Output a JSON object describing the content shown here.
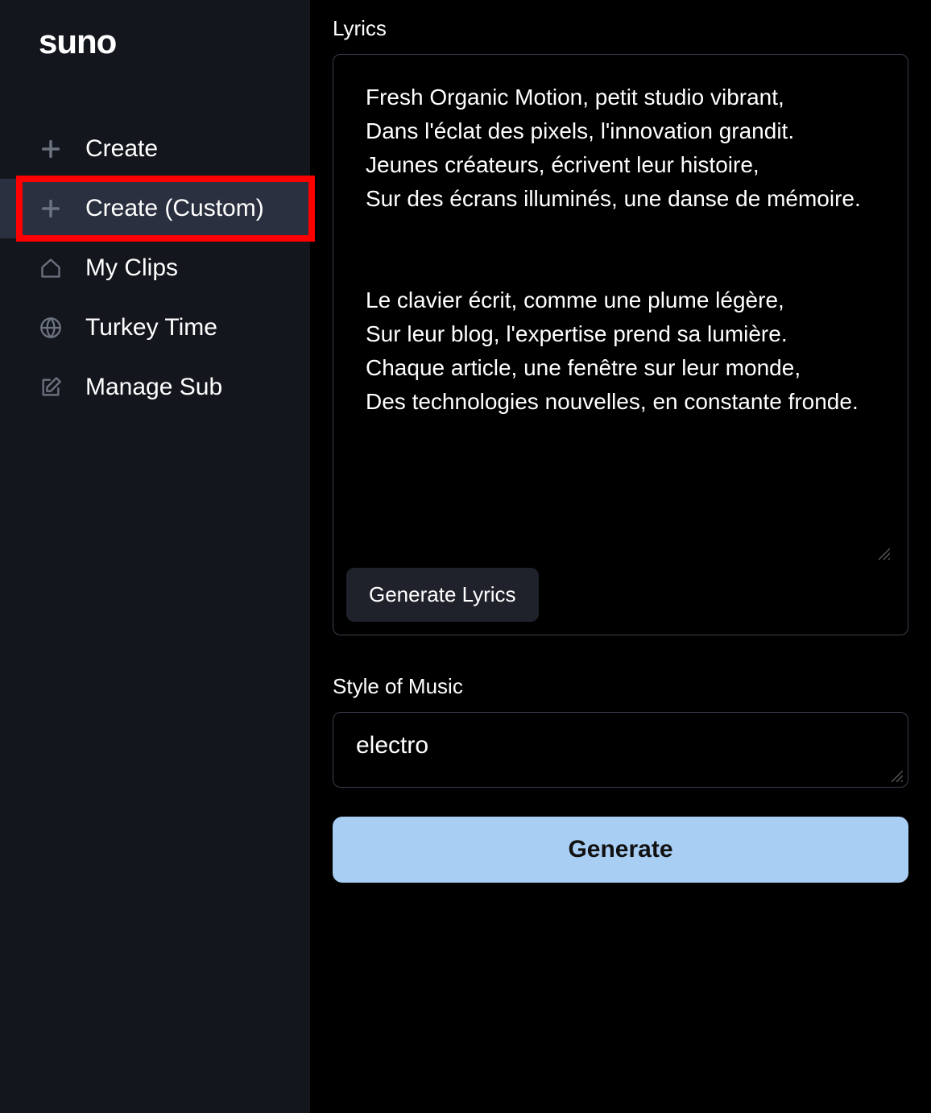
{
  "brand": "suno",
  "sidebar": {
    "items": [
      {
        "label": "Create",
        "icon": "plus"
      },
      {
        "label": "Create (Custom)",
        "icon": "plus",
        "active": true,
        "highlighted": true
      },
      {
        "label": "My Clips",
        "icon": "home"
      },
      {
        "label": "Turkey Time",
        "icon": "globe"
      },
      {
        "label": "Manage Sub",
        "icon": "edit"
      }
    ]
  },
  "form": {
    "lyrics_label": "Lyrics",
    "lyrics_value": "Fresh Organic Motion, petit studio vibrant,\nDans l'éclat des pixels, l'innovation grandit.\nJeunes créateurs, écrivent leur histoire,\nSur des écrans illuminés, une danse de mémoire.\n\n\nLe clavier écrit, comme une plume légère,\nSur leur blog, l'expertise prend sa lumière.\nChaque article, une fenêtre sur leur monde,\nDes technologies nouvelles, en constante fronde.",
    "generate_lyrics_label": "Generate Lyrics",
    "style_label": "Style of Music",
    "style_value": "electro",
    "generate_label": "Generate"
  }
}
